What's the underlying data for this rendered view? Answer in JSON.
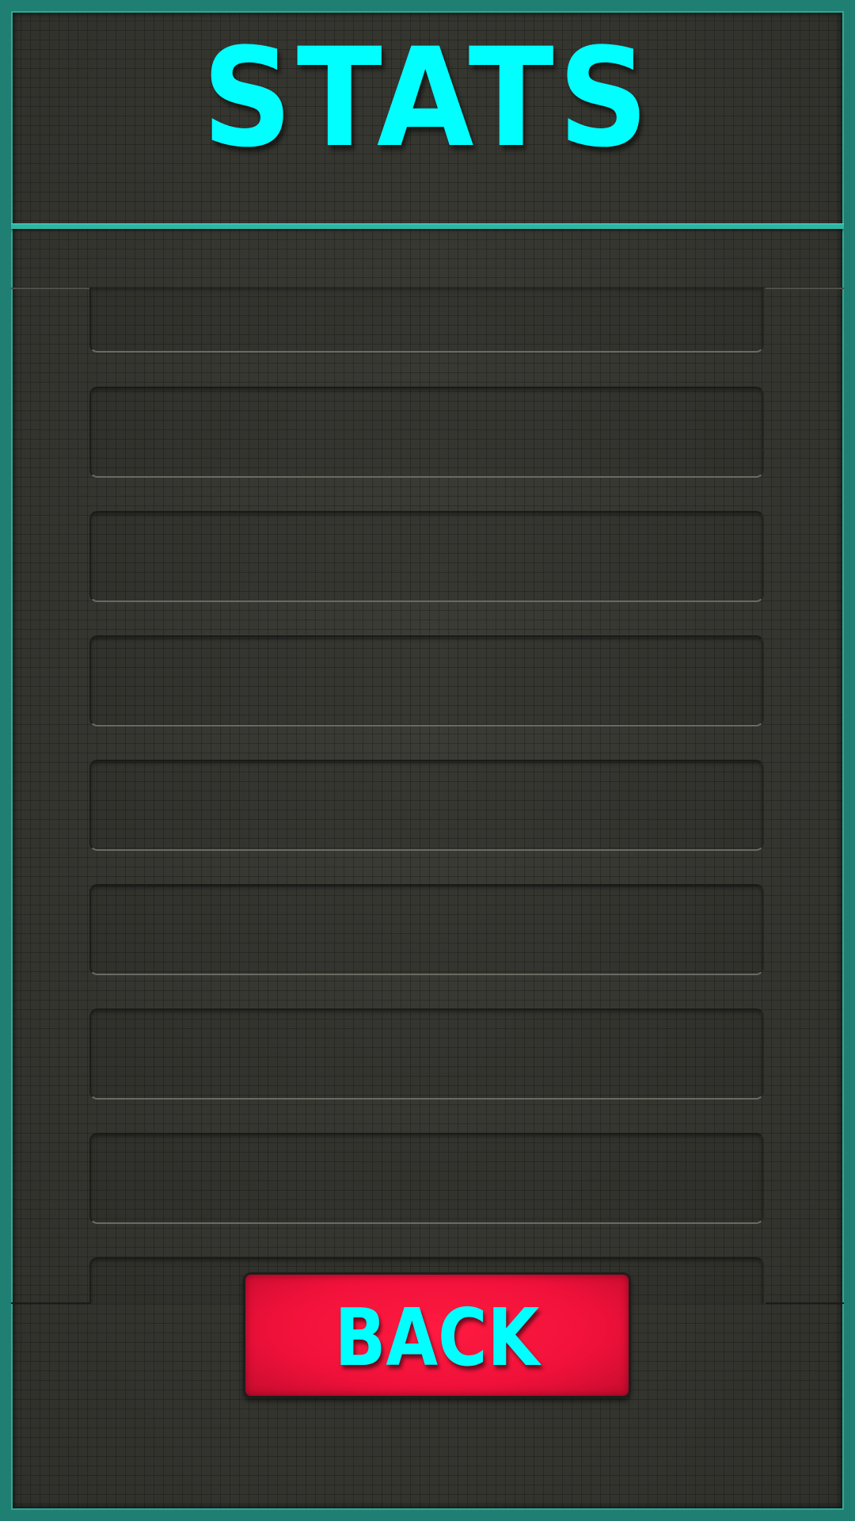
{
  "screen": {
    "title": "STATS",
    "accent_color": "#00ffff",
    "frame_color": "#1f7f72",
    "background_color": "#363631"
  },
  "stats": {
    "slots": [
      {
        "text": ""
      },
      {
        "text": ""
      },
      {
        "text": ""
      },
      {
        "text": ""
      },
      {
        "text": ""
      },
      {
        "text": ""
      },
      {
        "text": ""
      },
      {
        "text": ""
      },
      {
        "text": ""
      }
    ]
  },
  "back_button": {
    "label": "BACK",
    "color": "#ff1a40"
  }
}
